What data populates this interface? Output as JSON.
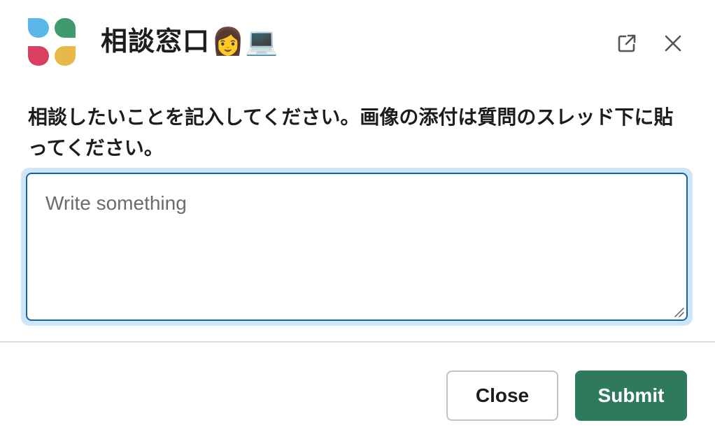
{
  "header": {
    "title": "相談窓口",
    "title_emojis": "👩💻",
    "logo": {
      "icon": "four-petal-app-logo",
      "colors": [
        "#5bb7e8",
        "#3f9b6e",
        "#d93f60",
        "#e8b84a"
      ]
    },
    "open_external_icon": "external-link-icon",
    "close_icon": "close-icon"
  },
  "form": {
    "instruction": "相談したいことを記入してください。画像の添付は質問のスレッド下に貼ってください。",
    "placeholder": "Write something",
    "value": ""
  },
  "footer": {
    "close_label": "Close",
    "submit_label": "Submit"
  },
  "colors": {
    "submit_bg": "#2f7a5c",
    "focus_border": "#1264a3",
    "focus_ring": "#cfe6f8"
  }
}
